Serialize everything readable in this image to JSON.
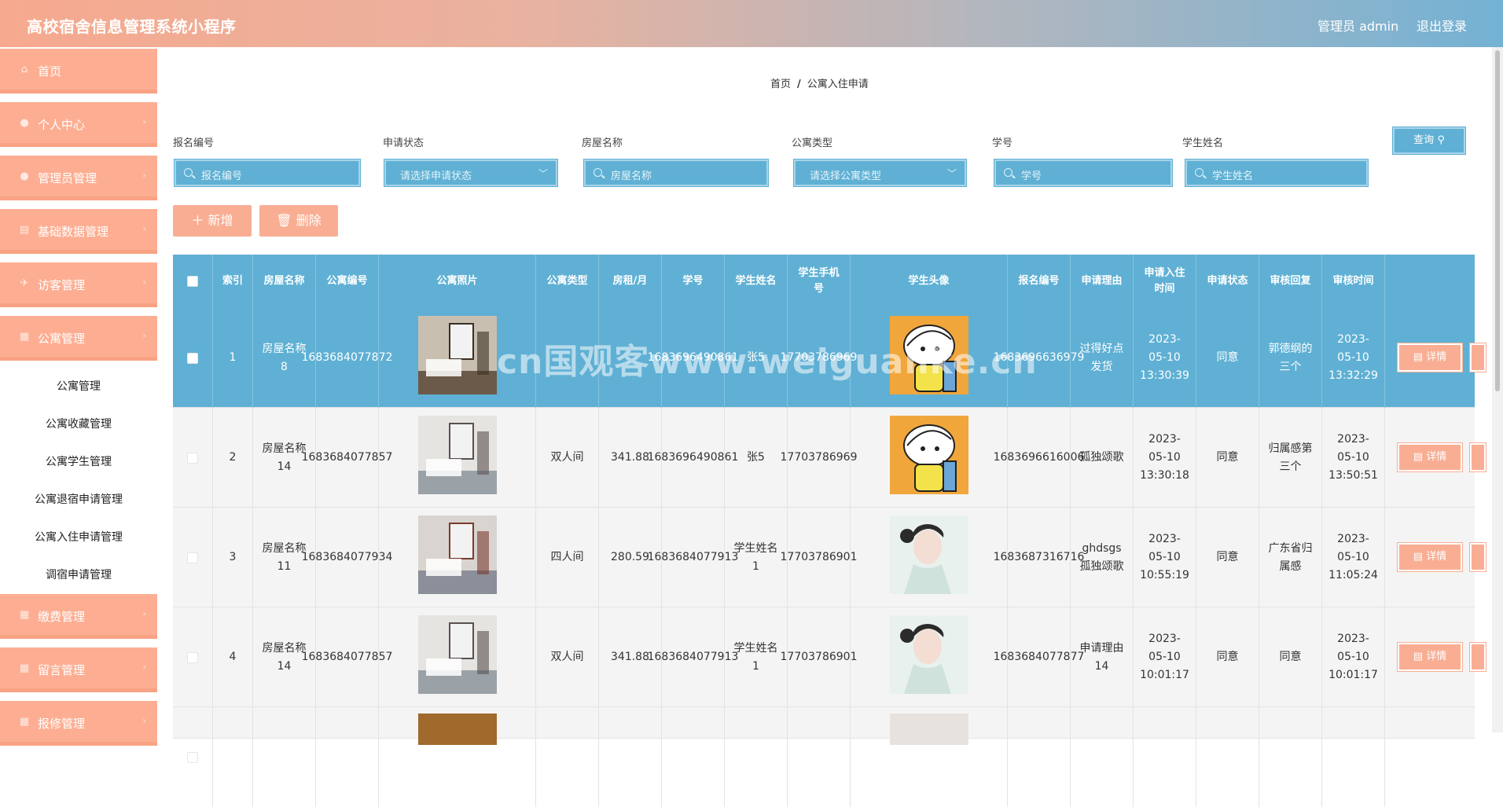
{
  "app": {
    "title": "高校宿舍信息管理系统小程序",
    "admin_label": "管理员 admin",
    "logout_label": "退出登录"
  },
  "sidebar": {
    "items": [
      {
        "label": "首页",
        "icon": "home-icon"
      },
      {
        "label": "个人中心",
        "icon": "user-icon"
      },
      {
        "label": "管理员管理",
        "icon": "user-admin-icon"
      },
      {
        "label": "基础数据管理",
        "icon": "data-icon"
      },
      {
        "label": "访客管理",
        "icon": "visitor-icon"
      },
      {
        "label": "公寓管理",
        "icon": "grid-icon"
      }
    ],
    "sub_items": [
      "公寓管理",
      "公寓收藏管理",
      "公寓学生管理",
      "公寓退宿申请管理",
      "公寓入住申请管理",
      "调宿申请管理"
    ],
    "items_after": [
      {
        "label": "缴费管理",
        "icon": "payment-icon"
      },
      {
        "label": "留言管理",
        "icon": "message-icon"
      },
      {
        "label": "报修管理",
        "icon": "repair-icon"
      }
    ]
  },
  "breadcrumb": {
    "home": "首页",
    "sep": "/",
    "current": "公寓入住申请"
  },
  "filters": {
    "report_no": {
      "label": "报名编号",
      "placeholder": "报名编号"
    },
    "status": {
      "label": "申请状态",
      "placeholder": "请选择申请状态"
    },
    "room_name": {
      "label": "房屋名称",
      "placeholder": "房屋名称"
    },
    "apt_type": {
      "label": "公寓类型",
      "placeholder": "请选择公寓类型"
    },
    "student_no": {
      "label": "学号",
      "placeholder": "学号"
    },
    "student_name": {
      "label": "学生姓名",
      "placeholder": "学生姓名"
    },
    "query_label": "查询"
  },
  "actions": {
    "add_label": "新增",
    "delete_label": "删除"
  },
  "table": {
    "headers": [
      "索引",
      "房屋名称",
      "公寓编号",
      "公寓照片",
      "公寓类型",
      "房租/月",
      "学号",
      "学生姓名",
      "学生手机号",
      "学生头像",
      "报名编号",
      "申请理由",
      "申请入住时间",
      "申请状态",
      "审核回复",
      "审核时间"
    ],
    "detail_label": "详情",
    "rows": [
      {
        "idx": "1",
        "room": "房屋名称8",
        "apt_no": "1683684077872",
        "type": "",
        "rent": "",
        "stu_no": "1683696490861",
        "stu_name": "张5",
        "phone": "17703786969",
        "report_no": "1683696636979",
        "reason": "过得好点发货",
        "apply_time": "2023-05-10 13:30:39",
        "status": "同意",
        "reply": "郭德纲的三个",
        "review_time": "2023-05-10 13:32:29"
      },
      {
        "idx": "2",
        "room": "房屋名称14",
        "apt_no": "1683684077857",
        "type": "双人间",
        "rent": "341.88",
        "stu_no": "1683696490861",
        "stu_name": "张5",
        "phone": "17703786969",
        "report_no": "1683696616006",
        "reason": "孤独颂歌",
        "apply_time": "2023-05-10 13:30:18",
        "status": "同意",
        "reply": "归属感第三个",
        "review_time": "2023-05-10 13:50:51"
      },
      {
        "idx": "3",
        "room": "房屋名称11",
        "apt_no": "1683684077934",
        "type": "四人间",
        "rent": "280.59",
        "stu_no": "1683684077913",
        "stu_name": "学生姓名1",
        "phone": "17703786901",
        "report_no": "1683687316716",
        "reason": "ghdsgs孤独颂歌",
        "apply_time": "2023-05-10 10:55:19",
        "status": "同意",
        "reply": "广东省归属感",
        "review_time": "2023-05-10 11:05:24"
      },
      {
        "idx": "4",
        "room": "房屋名称14",
        "apt_no": "1683684077857",
        "type": "双人间",
        "rent": "341.88",
        "stu_no": "1683684077913",
        "stu_name": "学生姓名1",
        "phone": "17703786901",
        "report_no": "1683684077877",
        "reason": "申请理由14",
        "apply_time": "2023-05-10 10:01:17",
        "status": "同意",
        "reply": "同意",
        "review_time": "2023-05-10 10:01:17"
      }
    ]
  },
  "watermark": "cn国观客www.weiguanke.cn"
}
